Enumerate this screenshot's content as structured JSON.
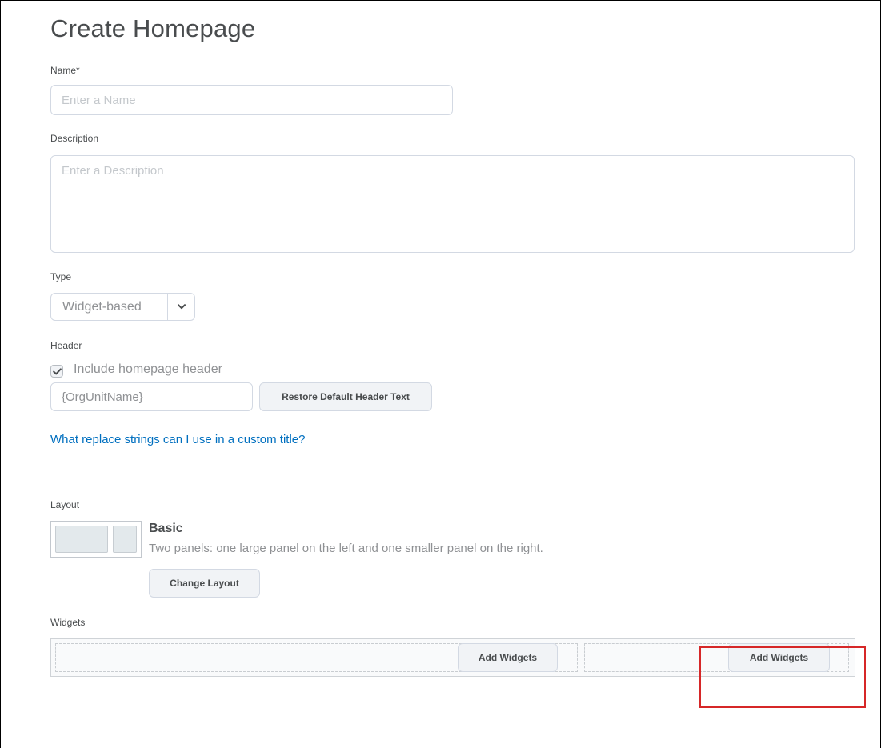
{
  "page": {
    "title": "Create Homepage"
  },
  "name_field": {
    "label": "Name*",
    "placeholder": "Enter a Name",
    "value": ""
  },
  "description_field": {
    "label": "Description",
    "placeholder": "Enter a Description",
    "value": ""
  },
  "type_field": {
    "label": "Type",
    "selected": "Widget-based"
  },
  "header_section": {
    "label": "Header",
    "checkbox_label": "Include homepage header",
    "checkbox_checked": true,
    "header_text_value": "{OrgUnitName}",
    "restore_button": "Restore Default Header Text",
    "help_link": "What replace strings can I use in a custom title?"
  },
  "layout_section": {
    "label": "Layout",
    "layout_name": "Basic",
    "layout_description": "Two panels: one large panel on the left and one smaller panel on the right.",
    "change_button": "Change Layout"
  },
  "widgets_section": {
    "label": "Widgets",
    "left_panel_button": "Add Widgets",
    "right_panel_button": "Add Widgets"
  },
  "colors": {
    "link": "#006fbf",
    "highlight": "#d62728",
    "button_bg": "#f1f3f6",
    "border": "#d3d9e3"
  }
}
